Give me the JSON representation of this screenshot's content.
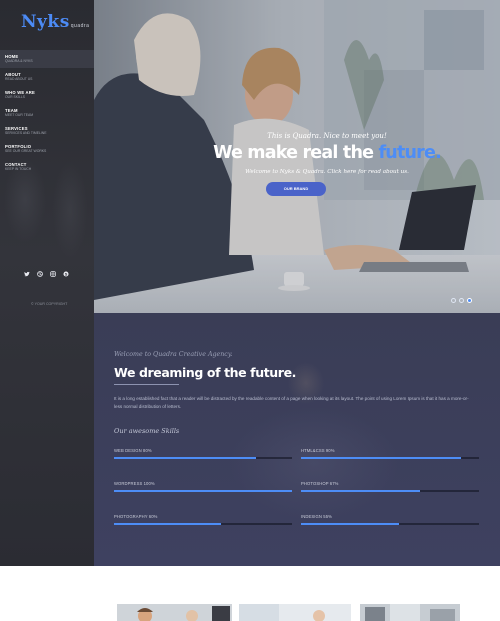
{
  "brand": {
    "name": "Nyks",
    "tagline": "quadra"
  },
  "nav": [
    {
      "label": "HOME",
      "sub": "QUADRA & NYKS"
    },
    {
      "label": "ABOUT",
      "sub": "READ ABOUT US"
    },
    {
      "label": "WHO WE ARE",
      "sub": "OUR SKILLS"
    },
    {
      "label": "TEAM",
      "sub": "MEET OUR TEAM"
    },
    {
      "label": "SERVICES",
      "sub": "SERVICES AND TIMELINE"
    },
    {
      "label": "PORTFOLIO",
      "sub": "SEE OUR GREAT WORKS"
    },
    {
      "label": "CONTACT",
      "sub": "KEEP IN TOUCH"
    }
  ],
  "social": [
    "twitter-icon",
    "dribbble-icon",
    "instagram-icon",
    "skype-icon"
  ],
  "copyright": "© YOUR COPYRIGHT",
  "hero": {
    "tagline": "This is Quadra. Nice to meet you!",
    "title_main": "We make real the",
    "title_highlight": "future.",
    "subtitle": "Welcome to Nyks & Quadra. Click here for read about us.",
    "button": "OUR BRAND",
    "slides": 3,
    "active_slide": 3
  },
  "about": {
    "kicker": "Welcome to Quadra Creative Agency.",
    "title": "We dreaming of the future.",
    "text": "It is a long established fact that a reader will be distracted by the readable content of a page when looking at its layout. The point of using Lorem Ipsum is that it has a more-or-less normal distribution of letters.",
    "skills_heading": "Our awesome Skills",
    "skills": [
      {
        "label": "WEB DESIGN 80%",
        "value": 80
      },
      {
        "label": "HTML&CSS 90%",
        "value": 90
      },
      {
        "label": "WORDPRESS 100%",
        "value": 100
      },
      {
        "label": "PHOTOSHOP 67%",
        "value": 67
      },
      {
        "label": "PHOTOGRAPHY 60%",
        "value": 60
      },
      {
        "label": "INDESIGN 55%",
        "value": 55
      }
    ]
  },
  "colors": {
    "accent": "#4d8df6",
    "sidebar": "#2b2c33",
    "about_bg": "#3b3e57",
    "button": "#4a63c9"
  }
}
